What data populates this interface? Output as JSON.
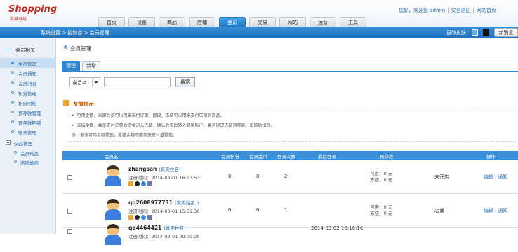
{
  "app": {
    "logo": "Shopping",
    "logo_sub": "商城系统",
    "user_info": {
      "greeting": "您好，欢迎您 admin",
      "safe_exit": "安全退出",
      "home": "网站首页"
    }
  },
  "nav": {
    "tabs": [
      "首页",
      "设置",
      "商品",
      "店铺",
      "会员",
      "交易",
      "网站",
      "运营",
      "工具"
    ],
    "active_index": 4
  },
  "bluebar": {
    "breadcrumb": "系统设置 > 控制台 > 会员管理",
    "skin_label": "更改皮肤：",
    "new_message": "新消息"
  },
  "sidebar": {
    "section_title": "会员相关",
    "items": [
      "会员管理",
      "会员通知",
      "会员消息",
      "积分管理",
      "积分明细",
      "预存款管理",
      "预存款明细",
      "聊天管理"
    ],
    "active_index": 0,
    "group": {
      "title": "SNS管理",
      "children": [
        "会员动态",
        "店铺动态"
      ]
    }
  },
  "main": {
    "title": "会员管理",
    "tabs": [
      "管理",
      "新增"
    ],
    "active_tab": 0,
    "search": {
      "field_select": "会员名",
      "input_value": "",
      "button": "搜索"
    },
    "tips": {
      "title": "友情提示",
      "lines": [
        "可用金额，来源会员可以用来支付订单，提现，冻结可以用来支付店铺的商品。",
        "冻结金额，会员支付订单后资金进入冻结，确认收货后转入商家账户，会员提现冻结预存款，审核后扣除。",
        "多，更多可用金额提现，冻结金额不能用来支付或提现。"
      ]
    },
    "table": {
      "headers": [
        "会员名",
        "会员积分",
        "会员金币",
        "登录次数",
        "最后登录",
        "预存款",
        "",
        "操作"
      ],
      "rows": [
        {
          "username": "zhangsan",
          "real_name": "(真实姓名：)",
          "reg_time": "注册时间：2014-03-01 16:13:53",
          "points": "0",
          "coins": "0",
          "logins": "2",
          "last_login": "",
          "available": "可用：0 元",
          "frozen": "冻结：0 元",
          "store": "未开店",
          "ops": [
            "编辑",
            "通知"
          ]
        },
        {
          "username": "qq2608977731",
          "real_name": "(真实姓名：)",
          "reg_time": "注册时间：2014-03-01 15:51:36",
          "points": "0",
          "coins": "0",
          "logins": "1",
          "last_login": "",
          "available": "可用：0 元",
          "frozen": "冻结：0 元",
          "store": "店铺",
          "ops": [
            "编辑",
            "通知"
          ]
        },
        {
          "username": "qq4464421",
          "real_name": "(真实姓名：)",
          "reg_time": "注册时间：2014-03-01 09:09:28",
          "points": "",
          "coins": "",
          "logins": "",
          "last_login": "2014-03-02 10:16:16",
          "available": "",
          "frozen": "",
          "store": "",
          "ops": []
        }
      ]
    }
  },
  "colors": {
    "primary_blue": "#2f86d2",
    "header_blue": "#1d6fb8",
    "sidebar_bg": "#eaf1f9",
    "logo_red": "#c0281e"
  }
}
